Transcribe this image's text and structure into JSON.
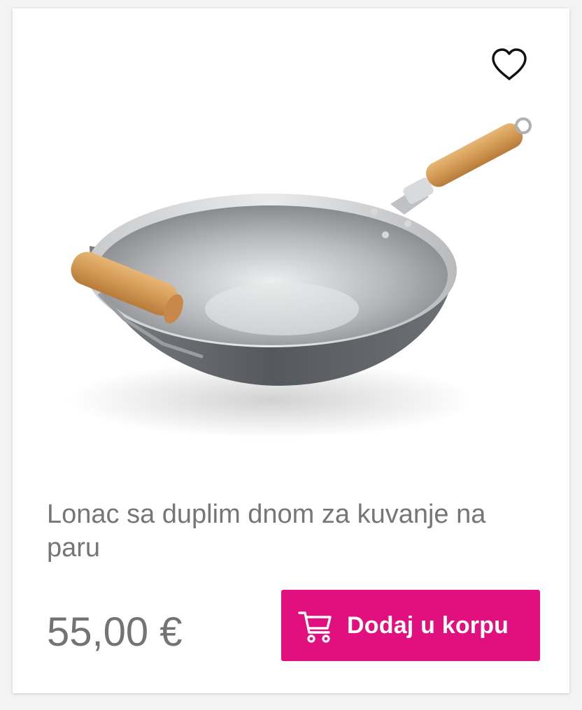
{
  "product": {
    "title": "Lonac sa duplim dnom za kuvanje na paru",
    "price": "55,00 €",
    "image_icon": "wok-image",
    "favorite_icon": "heart-outline-icon"
  },
  "actions": {
    "add_to_cart_label": "Dodaj u korpu",
    "cart_icon": "shopping-cart-icon"
  },
  "colors": {
    "accent": "#e20f7f",
    "text_muted": "#767676",
    "background": "#ffffff"
  }
}
